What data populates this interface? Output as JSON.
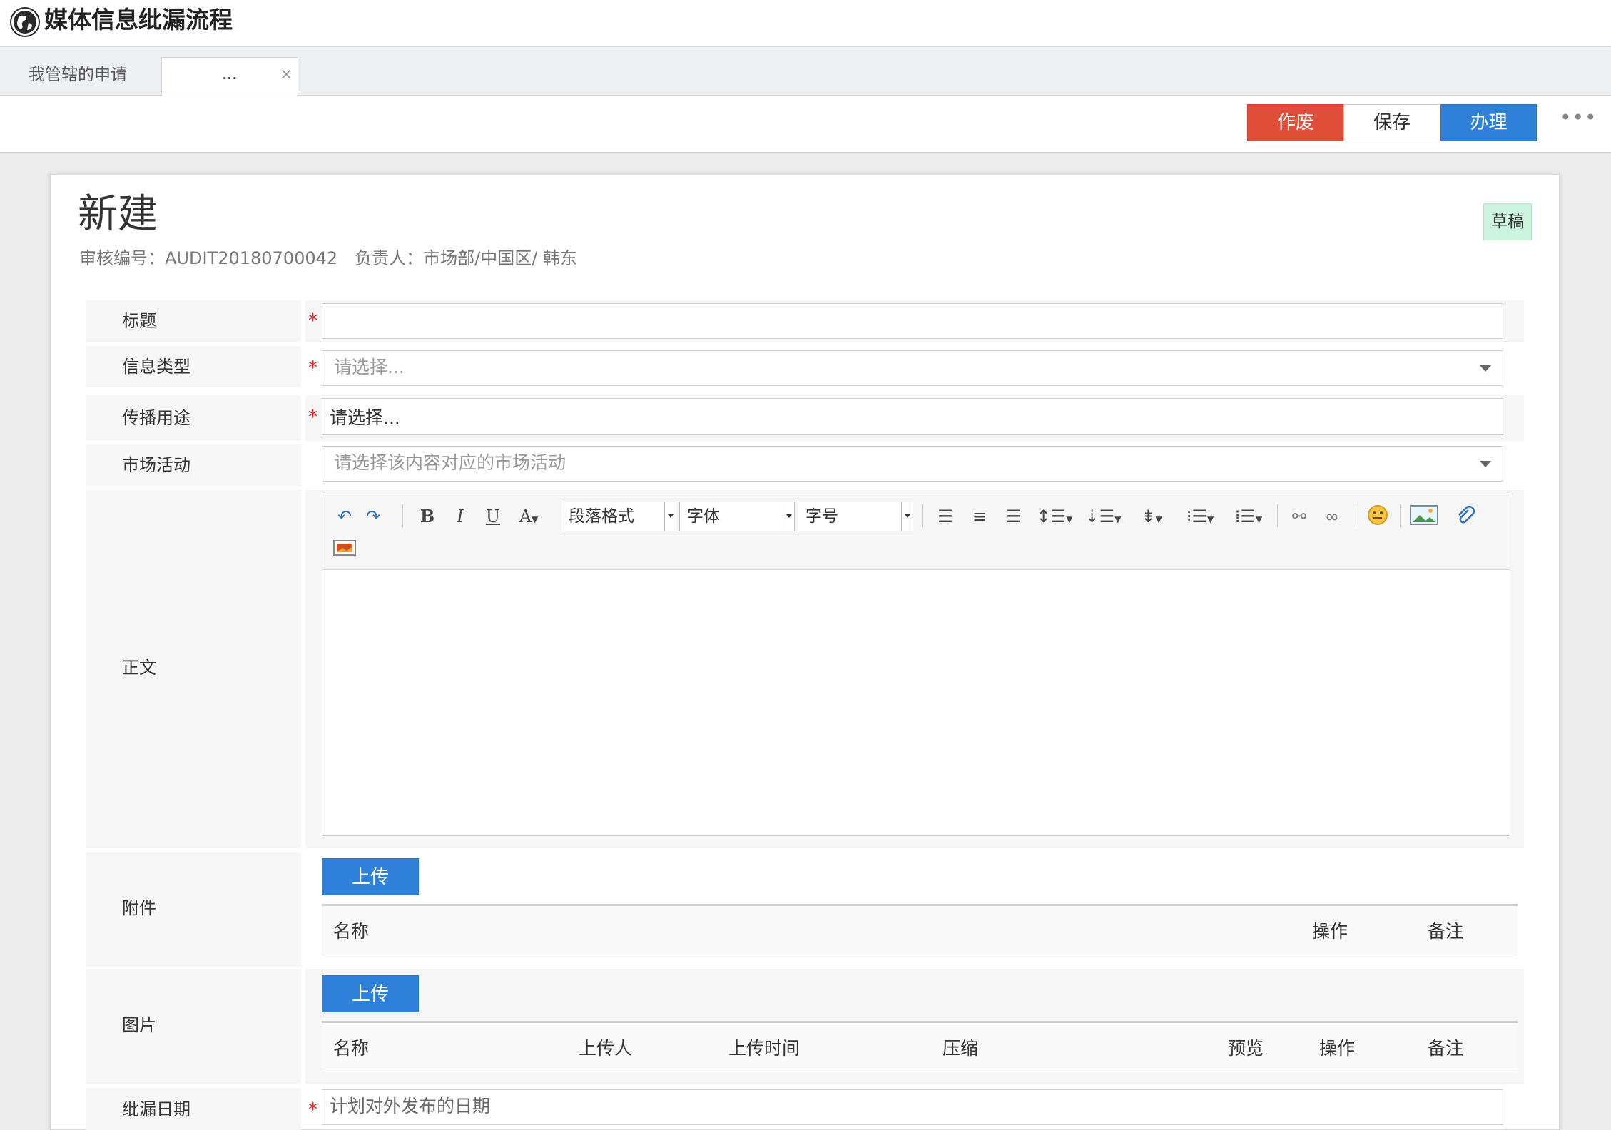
{
  "app": {
    "title": "媒体信息纰漏流程"
  },
  "tabs": [
    {
      "label": "我管辖的申请"
    },
    {
      "label": "...",
      "close": "×"
    }
  ],
  "actions": {
    "void": "作废",
    "save": "保存",
    "handle": "办理",
    "more": "•••"
  },
  "doc": {
    "title": "新建",
    "audit_no": "审核编号：AUDIT20180700042",
    "owner": "负责人：市场部/中国区/ 韩东",
    "status": "草稿"
  },
  "form": {
    "required_mark": "*",
    "title_label": "标题",
    "title_value": "",
    "info_type_label": "信息类型",
    "info_type_placeholder": "请选择...",
    "purpose_label": "传播用途",
    "purpose_placeholder": "请选择...",
    "campaign_label": "市场活动",
    "campaign_placeholder": "请选择该内容对应的市场活动",
    "body_label": "正文",
    "attach_label": "附件",
    "image_label": "图片",
    "date_label": "纰漏日期",
    "date_placeholder": "计划对外发布的日期"
  },
  "editor": {
    "paragraph": "段落格式",
    "font": "字体",
    "size": "字号",
    "icons": [
      "undo-icon",
      "redo-icon",
      "bold-icon",
      "italic-icon",
      "underline-icon",
      "font-color-icon",
      "align-left-icon",
      "align-center-icon",
      "align-right-icon",
      "line-height-icon",
      "indent-icon",
      "paragraph-spacing-icon",
      "ordered-list-icon",
      "unordered-list-icon",
      "unlink-icon",
      "link-icon",
      "emoji-icon",
      "image-icon",
      "attachment-icon",
      "video-icon"
    ]
  },
  "attachments": {
    "upload": "上传",
    "columns": [
      "名称",
      "操作",
      "备注"
    ]
  },
  "images": {
    "upload": "上传",
    "columns": [
      "名称",
      "上传人",
      "上传时间",
      "压缩",
      "预览",
      "操作",
      "备注"
    ]
  },
  "colors": {
    "danger": "#e04e39",
    "primary": "#2f80d8",
    "draft_badge": "#cbf3de",
    "required": "#e02020"
  }
}
